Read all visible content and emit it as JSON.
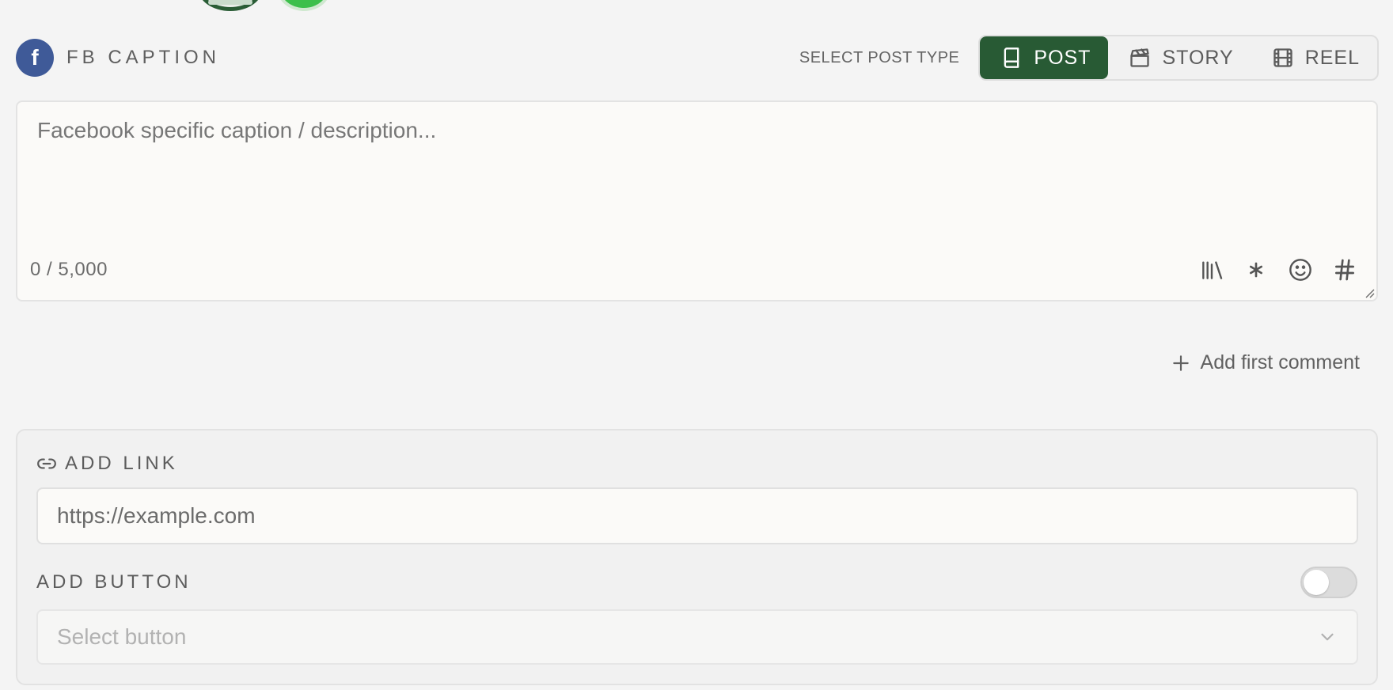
{
  "header": {
    "title": "FB CAPTION",
    "select_post_type_label": "SELECT POST TYPE",
    "post_types": [
      {
        "label": "POST",
        "icon": "book-icon",
        "active": true
      },
      {
        "label": "STORY",
        "icon": "clapperboard-icon",
        "active": false
      },
      {
        "label": "REEL",
        "icon": "film-icon",
        "active": false
      }
    ]
  },
  "caption": {
    "placeholder": "Facebook specific caption / description...",
    "counter": "0 / 5,000",
    "tools": [
      "library-icon",
      "asterisk-icon",
      "emoji-icon",
      "hashtag-icon"
    ]
  },
  "first_comment": {
    "label": "Add first comment"
  },
  "link_panel": {
    "title": "ADD LINK",
    "url_placeholder": "https://example.com",
    "add_button_label": "ADD BUTTON",
    "toggle_on": false,
    "select_placeholder": "Select button"
  },
  "colors": {
    "accent": "#285a34",
    "facebook": "#3f5a98",
    "background": "#f4f4f4"
  }
}
